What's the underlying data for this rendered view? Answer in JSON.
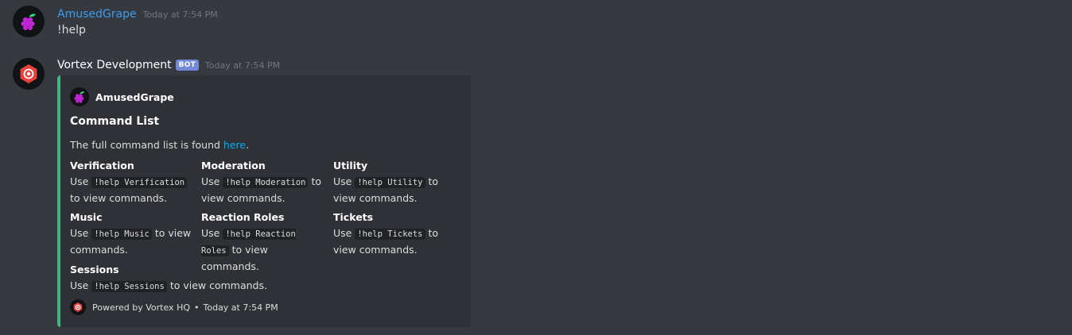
{
  "colors": {
    "background": "#36393f",
    "embed_background": "#2f3136",
    "embed_accent": "#43b581",
    "link": "#00b0f4",
    "username_grape": "#3b9df0",
    "bot_tag": "#7289da"
  },
  "messages": [
    {
      "author": "AmusedGrape",
      "avatar_icon": "grape-icon",
      "timestamp": "Today at 7:54 PM",
      "content": "!help"
    },
    {
      "author": "Vortex Development",
      "avatar_icon": "vortex-hexagon-icon",
      "bot_tag": "BOT",
      "timestamp": "Today at 7:54 PM",
      "embed": {
        "author": "AmusedGrape",
        "title": "Command List",
        "description_prefix": "The full command list is found ",
        "description_link": "here",
        "description_suffix": ".",
        "fields": [
          {
            "name": "Verification",
            "pre": "Use ",
            "code": "!help Verification",
            "post": " to view commands."
          },
          {
            "name": "Moderation",
            "pre": "Use ",
            "code": "!help Moderation",
            "post": " to view commands."
          },
          {
            "name": "Utility",
            "pre": "Use ",
            "code": "!help Utility",
            "post": " to view commands."
          },
          {
            "name": "Music",
            "pre": "Use ",
            "code": "!help Music",
            "post": " to view commands."
          },
          {
            "name": "Reaction Roles",
            "pre": "Use ",
            "code": "!help Reaction Roles",
            "post": " to view commands."
          },
          {
            "name": "Tickets",
            "pre": "Use ",
            "code": "!help Tickets",
            "post": " to view commands."
          },
          {
            "name": "Sessions",
            "pre": "Use ",
            "code": "!help Sessions",
            "post": " to view commands."
          }
        ],
        "footer_text": "Powered by Vortex HQ",
        "footer_separator": "•",
        "footer_timestamp": "Today at 7:54 PM"
      }
    }
  ]
}
